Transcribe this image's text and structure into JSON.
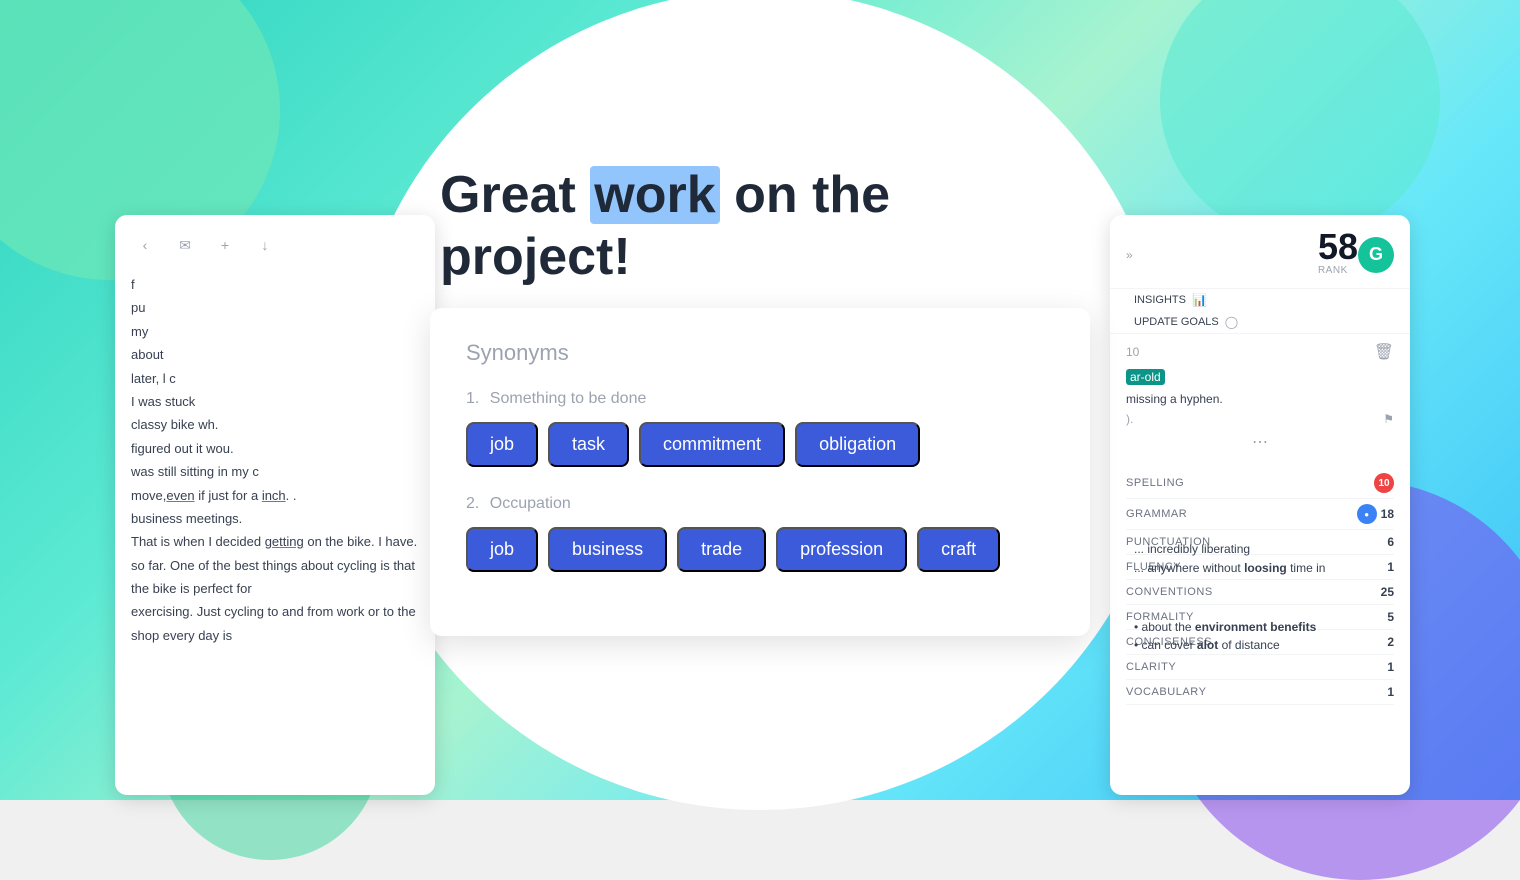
{
  "background": {
    "color_start": "#2dd4bf",
    "color_end": "#38bdf8"
  },
  "page_title": {
    "prefix": "Great ",
    "highlighted_word": "work",
    "suffix": " on the project!"
  },
  "synonym_popup": {
    "title": "Synonyms",
    "sections": [
      {
        "number": "1",
        "label": "Something to be done",
        "chips": [
          "job",
          "task",
          "commitment",
          "obligation"
        ]
      },
      {
        "number": "2",
        "label": "Occupation",
        "chips": [
          "job",
          "business",
          "trade",
          "profession",
          "craft"
        ]
      }
    ]
  },
  "right_panel": {
    "score": "58",
    "score_label": "RANK",
    "grammarly_letter": "G",
    "nav_items": [
      {
        "label": "INSIGHTS",
        "icon": "chart-icon"
      },
      {
        "label": "UPDATE GOALS",
        "icon": "target-icon"
      }
    ],
    "metrics": [
      {
        "label": "SPELLING",
        "value": "10",
        "type": "red"
      },
      {
        "label": "GRAMMAR",
        "value": "18",
        "type": "blue"
      },
      {
        "label": "PUNCTUATION",
        "value": "6"
      },
      {
        "label": "FLUENCY",
        "value": "1"
      },
      {
        "label": "CONVENTIONS",
        "value": "25"
      },
      {
        "label": "FORMALITY",
        "value": "5"
      },
      {
        "label": "CONCISENESS",
        "value": "2"
      },
      {
        "label": "CLARITY",
        "value": "1"
      },
      {
        "label": "VOCABULARY",
        "value": "1"
      }
    ],
    "correction_card": {
      "number": "10",
      "highlight": "ar-old",
      "text": "missing a hyphen.",
      "detail": ")."
    },
    "bullet_points": [
      {
        "text": "about the ",
        "bold": "environment benefits"
      },
      {
        "text": "can cover ",
        "bold": "alot",
        "suffix": " of distance"
      }
    ]
  },
  "left_panel": {
    "text_lines": [
      "f",
      "pu",
      "my",
      "about",
      "later, l c",
      "I was stuck",
      "classy bike wh.",
      "figured out it wou.",
      "was still sitting in my c",
      "move, even if just for a inch. .",
      "business meetings.",
      "That is when I decided getting on the bike. I have.",
      "so far. One of the best things about cycling is that the bike is perfect for",
      "exercising. Just cycling to and from work or to the shop every day is"
    ]
  }
}
